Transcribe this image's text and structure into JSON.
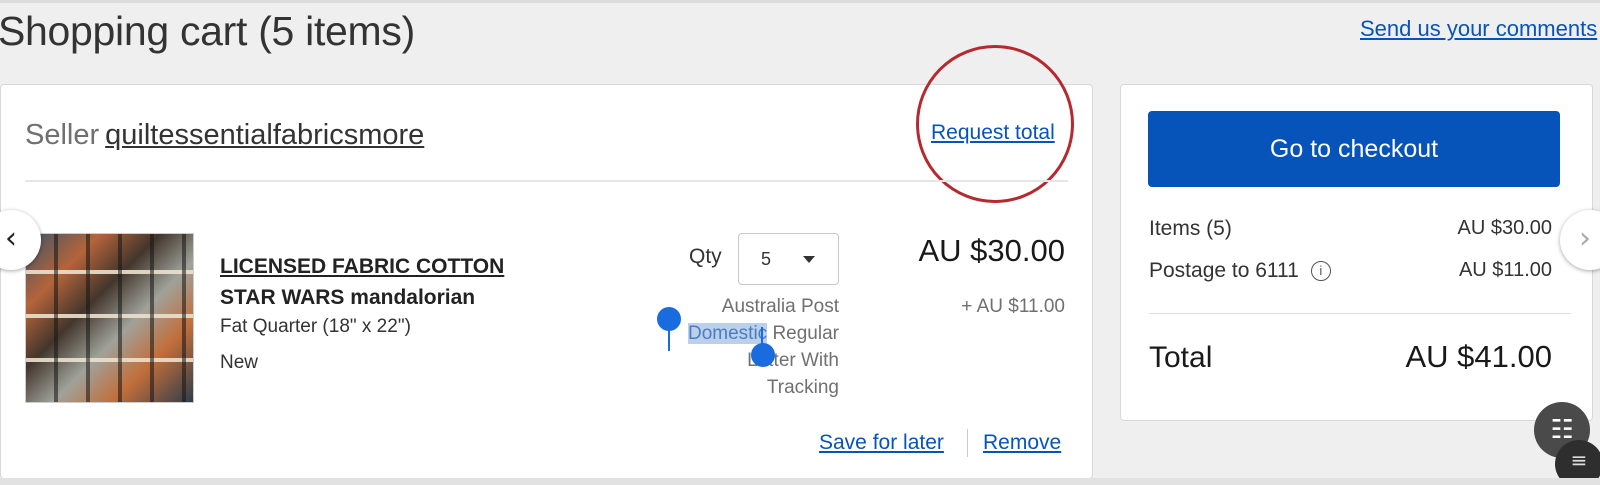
{
  "header": {
    "title": "Shopping cart (5 items)",
    "feedback_link": "Send us your comments"
  },
  "seller": {
    "label": "Seller",
    "name": "quiltessentialfabricsmore",
    "request_total": "Request total"
  },
  "item": {
    "title": "LICENSED FABRIC COTTON",
    "subtitle": "STAR WARS mandalorian",
    "variant": "Fat Quarter (18\" x 22\")",
    "condition": "New",
    "qty_label": "Qty",
    "qty_value": "5",
    "price": "AU $30.00",
    "postage_price": "+ AU $11.00",
    "shipping_line1": "Australia Post",
    "shipping_selected": "Domestic",
    "shipping_line2_rest": " Regular",
    "shipping_line3": "Letter With",
    "shipping_line4": "Tracking",
    "save_for_later": "Save for later",
    "remove": "Remove"
  },
  "summary": {
    "checkout_button": "Go to checkout",
    "items_label": "Items (5)",
    "items_value": "AU $30.00",
    "postage_label": "Postage to 6111",
    "postage_value": "AU $11.00",
    "total_label": "Total",
    "total_value": "AU $41.00"
  },
  "icons": {
    "info": "info-icon",
    "prev": "chevron-left-icon",
    "next": "chevron-right-icon",
    "scan": "scan-text-icon"
  },
  "colors": {
    "link": "#0654ba",
    "checkout_button": "#0654ba",
    "annotation_circle": "#b42a2f",
    "selection": "#1a6be0"
  }
}
